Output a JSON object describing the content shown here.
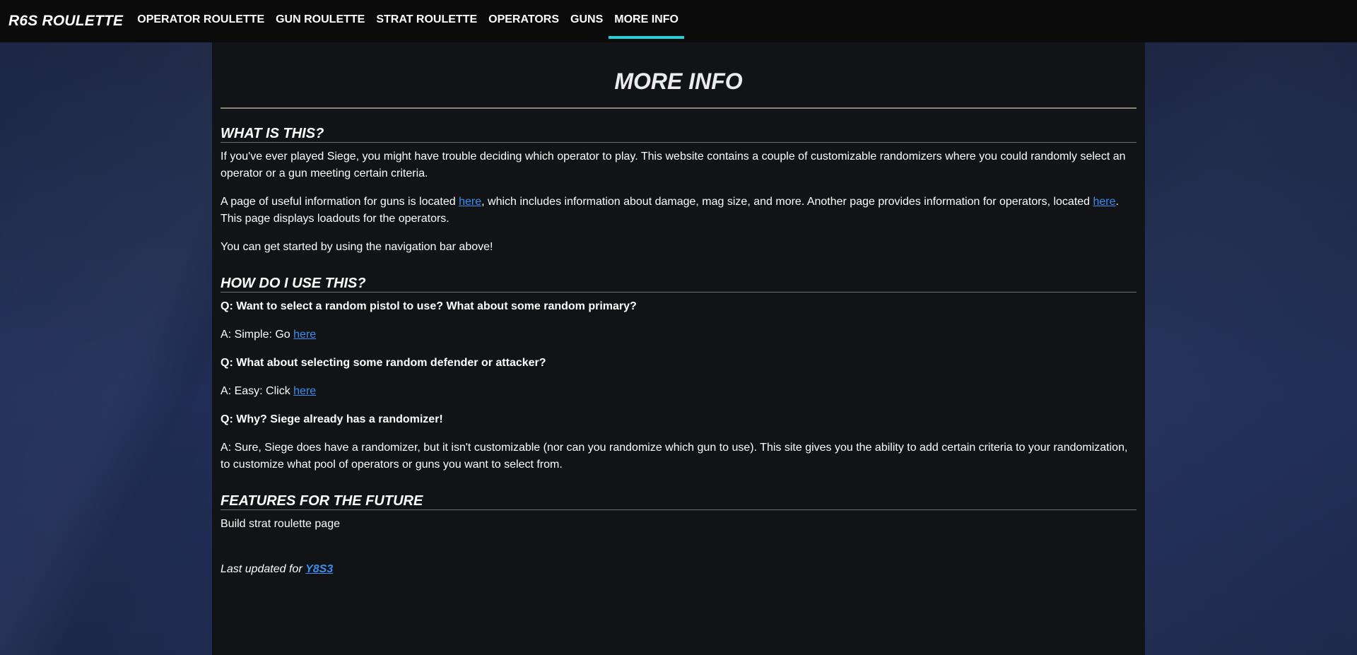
{
  "nav": {
    "brand": "R6S ROULETTE",
    "items": [
      {
        "label": "OPERATOR ROULETTE"
      },
      {
        "label": "GUN ROULETTE"
      },
      {
        "label": "STRAT ROULETTE"
      },
      {
        "label": "OPERATORS"
      },
      {
        "label": "GUNS"
      },
      {
        "label": "MORE INFO"
      }
    ],
    "active_index": 5,
    "accent_color": "#1fd2dc"
  },
  "page": {
    "title": "MORE INFO"
  },
  "what": {
    "heading": "WHAT IS THIS?",
    "p1": "If you've ever played Siege, you might have trouble deciding which operator to play. This website contains a couple of customizable randomizers where you could randomly select an operator or a gun meeting certain criteria.",
    "p2_a": "A page of useful information for guns is located ",
    "p2_link1": "here",
    "p2_b": ", which includes information about damage, mag size, and more. Another page provides information for operators, located ",
    "p2_link2": "here",
    "p2_c": ". This page displays loadouts for the operators.",
    "p3": "You can get started by using the navigation bar above!"
  },
  "how": {
    "heading": "HOW DO I USE THIS?",
    "q1": "Q: Want to select a random pistol to use? What about some random primary?",
    "a1_text": "A: Simple: Go ",
    "a1_link": "here",
    "q2": "Q: What about selecting some random defender or attacker?",
    "a2_text": "A: Easy: Click ",
    "a2_link": "here",
    "q3": "Q: Why? Siege already has a randomizer!",
    "a3": "A: Sure, Siege does have a randomizer, but it isn't customizable (nor can you randomize which gun to use). This site gives you the ability to add certain criteria to your randomization, to customize what pool of operators or guns you want to select from."
  },
  "future": {
    "heading": "FEATURES FOR THE FUTURE",
    "item": "Build strat roulette page"
  },
  "updated": {
    "text": "Last updated for ",
    "link": "Y8S3"
  },
  "colors": {
    "link": "#3b8ef0",
    "panel_bg": "#121316",
    "nav_bg": "#0b0b0b"
  }
}
